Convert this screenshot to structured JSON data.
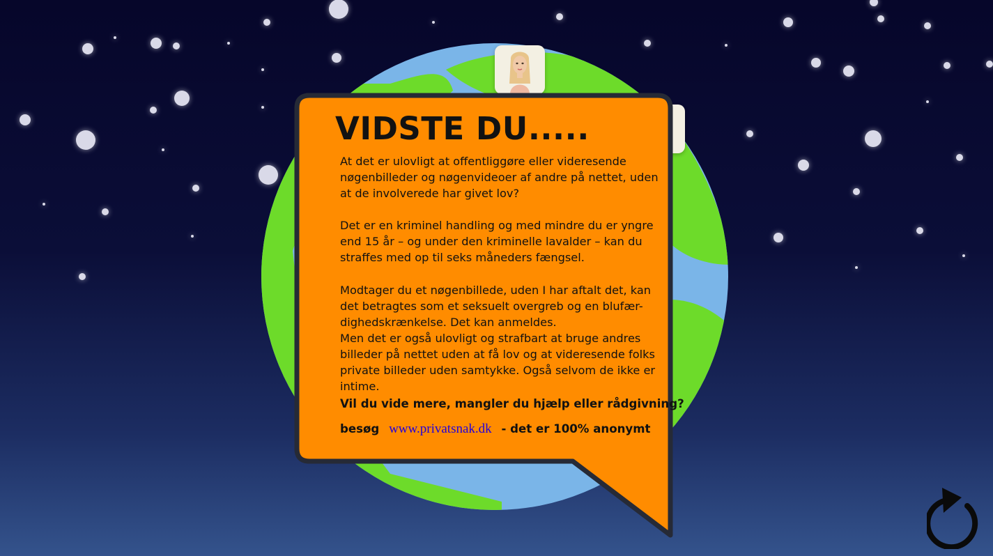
{
  "scene": {
    "title": "VIDSTE DU.....",
    "paragraphs": [
      "At det er ulovligt at offentliggøre eller videresende nøgenbilleder og nøgenvideoer af andre på nettet, uden at de involverede har givet lov?",
      "Det er en kriminel handling og med mindre du er yngre end 15 år – og under den kriminelle lavalder – kan du straffes med op til seks måneders fængsel.",
      "Modtager du et nøgenbillede, uden I har aftalt det, kan det betragtes som et seksuelt overgreb og en blufær-dighedskrænkelse. Det kan anmeldes.",
      "Men det er også ulovligt og strafbart at bruge andres billeder på nettet uden at få lov og at videresende folks private billeder uden samtykke. Også selvom de ikke er intime."
    ],
    "cta": "Vil du vide mere, mangler du hjælp eller rådgivning?",
    "visit_prefix": "besøg",
    "link_text": "www.privatsnak.dk",
    "visit_suffix": "- det er 100% anonymt"
  },
  "icons": {
    "restart": "restart-icon",
    "avatar": "avatar-icon"
  },
  "colors": {
    "bubble": "#ff8c00",
    "bubble_border": "#262a36",
    "ocean": "#7ab5e8",
    "land": "#6ddb2a",
    "link": "#2200dd",
    "sky_top": "#06062a",
    "sky_bottom": "#34538c"
  }
}
